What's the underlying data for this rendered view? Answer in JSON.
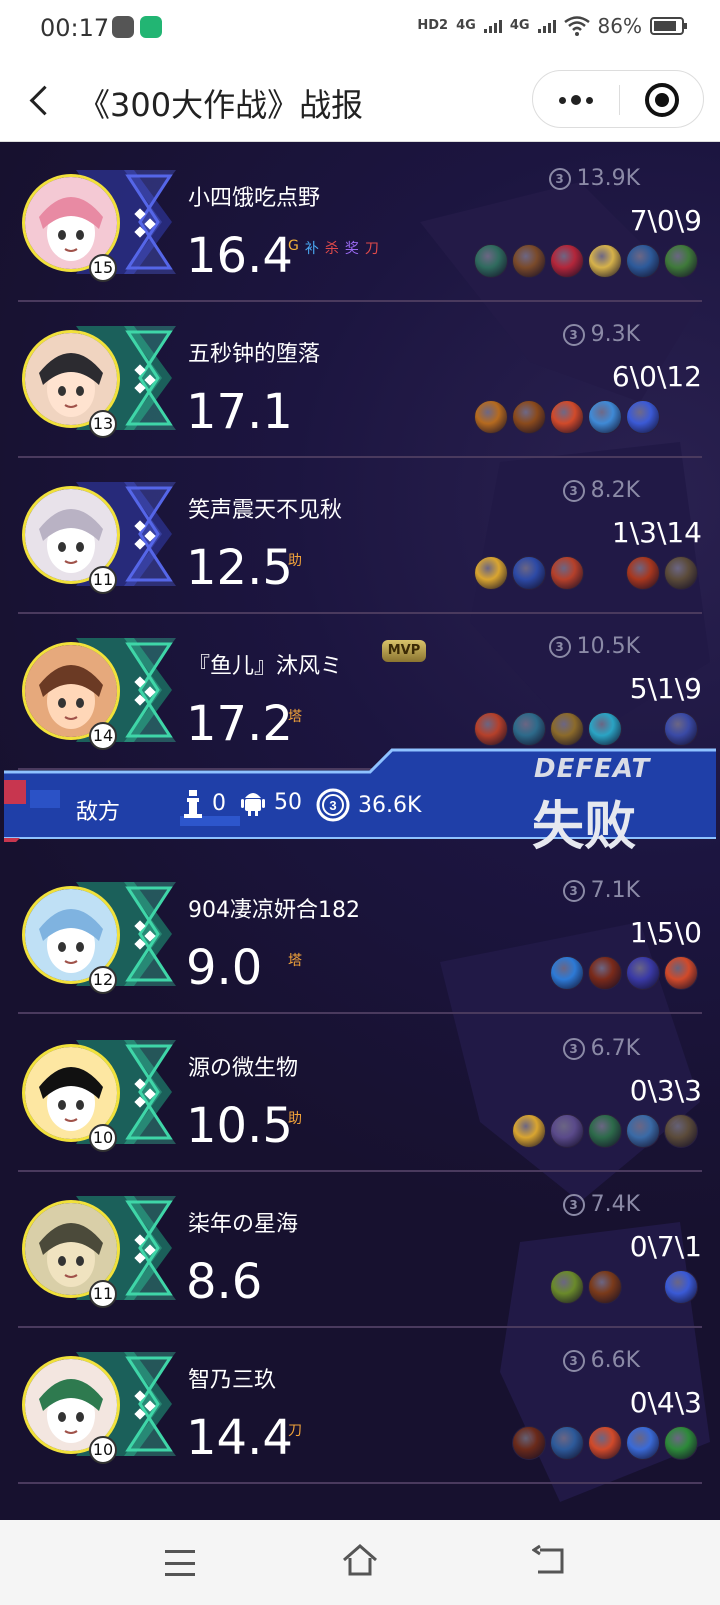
{
  "status": {
    "time": "00:17",
    "hd": "HD2",
    "net1": "4G",
    "net2": "4G",
    "battery": "86%",
    "battery_level": 0.86
  },
  "nav": {
    "title": "《300大作战》战报",
    "back_icon": "back-arrow-icon",
    "more_icon": "more-dots-icon",
    "close_icon": "close-target-icon"
  },
  "team": [
    {
      "name": "小四饿吃点野",
      "level": "15",
      "score": "16.4",
      "gold": "13.9K",
      "kda": "7\\0\\9",
      "tags": [
        "G",
        "补",
        "杀",
        "奖",
        "刀"
      ],
      "mvp": ""
    },
    {
      "name": "五秒钟的堕落",
      "level": "13",
      "score": "17.1",
      "gold": "9.3K",
      "kda": "6\\0\\12",
      "tags": [],
      "mvp": ""
    },
    {
      "name": "笑声震天不见秋",
      "level": "11",
      "score": "12.5",
      "gold": "8.2K",
      "kda": "1\\3\\14",
      "tags": [
        "助"
      ],
      "mvp": ""
    },
    {
      "name": "『鱼儿』沐风ミ",
      "level": "14",
      "score": "17.2",
      "gold": "10.5K",
      "kda": "5\\1\\9",
      "tags": [
        "塔"
      ],
      "mvp": "MVP"
    }
  ],
  "banner": {
    "label": "敌方",
    "towers": "0",
    "minions": "50",
    "gold": "36.6K",
    "result_en": "DEFEAT",
    "result_cn": "失败"
  },
  "enemy": [
    {
      "name": "904凄凉妍合182",
      "level": "12",
      "score": "9.0",
      "gold": "7.1K",
      "kda": "1\\5\\0",
      "tags": [
        "塔"
      ]
    },
    {
      "name": "源の微生物",
      "level": "10",
      "score": "10.5",
      "gold": "6.7K",
      "kda": "0\\3\\3",
      "tags": [
        "助"
      ]
    },
    {
      "name": "柒年の星海",
      "level": "11",
      "score": "8.6",
      "gold": "7.4K",
      "kda": "0\\7\\1",
      "tags": []
    },
    {
      "name": "智乃三玖",
      "level": "10",
      "score": "14.4",
      "gold": "6.6K",
      "kda": "0\\4\\3",
      "tags": [
        "刀"
      ]
    }
  ],
  "colors": {
    "background": "#17112f",
    "divider": "#4a3a5e",
    "avatar_ring": "#f1e13b",
    "banner_blue": "#1f3fa8",
    "gold_text": "#8b8aa6",
    "tag_orange": "#f2a33a"
  }
}
